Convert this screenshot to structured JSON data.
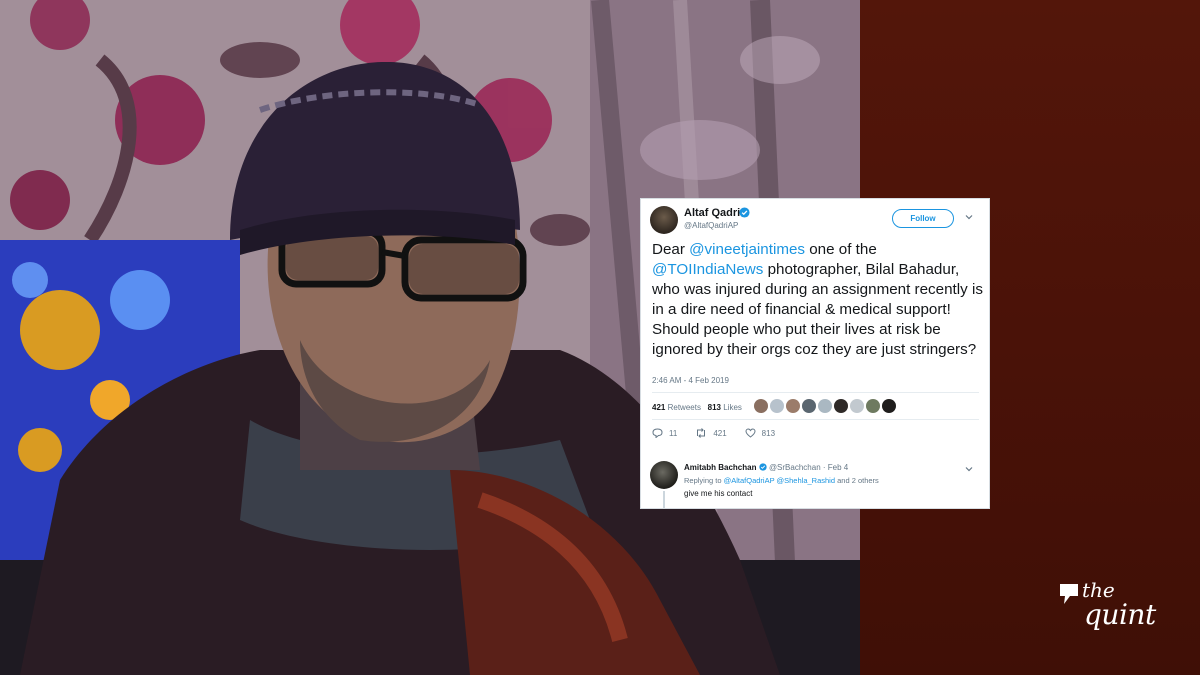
{
  "tweet": {
    "author_name": "Altaf Qadri",
    "author_handle": "@AltafQadriAP",
    "follow_label": "Follow",
    "body_part1": "Dear ",
    "mention1": "@vineetjaintimes",
    "body_part2": " one of the ",
    "mention2": "@TOIIndiaNews",
    "body_part3": " photographer, Bilal Bahadur, who was injured during an assignment recently is in a dire need of financial & medical support! Should people who put their lives at risk be ignored by their orgs coz they are just stringers?",
    "timestamp": "2:46 AM - 4 Feb 2019",
    "retweets_count": "421",
    "retweets_label": "Retweets",
    "likes_count": "813",
    "likes_label": "Likes",
    "reply_count": "11",
    "retweet_action_count": "421",
    "like_action_count": "813"
  },
  "reply": {
    "author_name": "Amitabh Bachchan",
    "author_handle": "@SrBachchan",
    "date": "· Feb 4",
    "replying_prefix": "Replying to ",
    "replying_mentions": "@AltafQadriAP @Shehla_Rashid",
    "replying_suffix": " and 2 others",
    "text": "give me his contact"
  },
  "logo": {
    "line1": "the",
    "line2": "quint"
  },
  "colors": {
    "twitter_blue": "#1b95e0",
    "panel_red": "#4a1208",
    "text_dark": "#14171a",
    "text_gray": "#657786"
  },
  "icons": [
    "verified-badge-icon",
    "chevron-down-icon",
    "reply-icon",
    "retweet-icon",
    "like-icon",
    "quint-logo-icon"
  ]
}
